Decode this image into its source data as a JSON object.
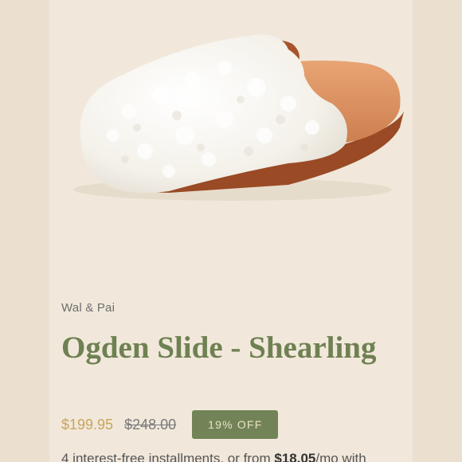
{
  "product": {
    "brand": "Wal & Pai",
    "title": "Ogden Slide - Shearling",
    "price": "$199.95",
    "original_price": "$248.00",
    "discount_badge": "19% OFF",
    "installments": {
      "text_before": "4 interest-free installments, or from ",
      "amount": "$18.05",
      "text_after": "/mo with"
    },
    "image_alt": "White shearling slide with tan footbed"
  },
  "colors": {
    "title": "#6f8152",
    "price": "#c9a45c",
    "badge_bg": "#728457",
    "background": "#f1e8db"
  }
}
